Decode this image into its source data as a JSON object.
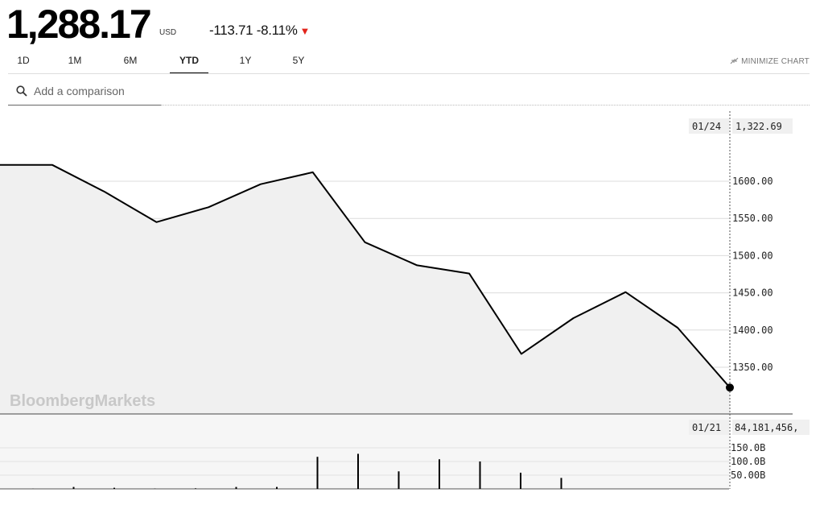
{
  "quote": {
    "price": "1,288.17",
    "currency": "USD",
    "change": "-113.71",
    "change_pct": "-8.11%",
    "direction_icon": "down-triangle-icon",
    "down_color": "#e2241b"
  },
  "tabs": [
    {
      "label": "1D",
      "active": false
    },
    {
      "label": "1M",
      "active": false
    },
    {
      "label": "6M",
      "active": false
    },
    {
      "label": "YTD",
      "active": true
    },
    {
      "label": "1Y",
      "active": false
    },
    {
      "label": "5Y",
      "active": false
    }
  ],
  "minimize_label": "MINIMIZE CHART",
  "search": {
    "placeholder": "Add a comparison",
    "icon": "search-icon"
  },
  "watermark": "BloombergMarkets",
  "chart_data": [
    {
      "type": "line",
      "series": [
        {
          "values": [
            1622,
            1622,
            1586,
            1545,
            1565,
            1596,
            1612,
            1518,
            1487,
            1476,
            1368,
            1416,
            1451,
            1403,
            1322.69
          ]
        }
      ],
      "y_ticks": [
        "1600.00",
        "1550.00",
        "1500.00",
        "1450.00",
        "1400.00",
        "1350.00"
      ],
      "ylim": [
        1300,
        1650
      ],
      "grid": true,
      "crosshair": {
        "date": "01/24",
        "value": "1,322.69"
      }
    },
    {
      "type": "bar",
      "values": [
        0.5,
        7,
        4,
        1,
        2,
        7,
        7,
        117,
        128,
        64,
        108,
        100,
        59,
        40
      ],
      "unit": "B",
      "y_ticks": [
        "150.0B",
        "100.0B",
        "50.00B"
      ],
      "ylim": [
        0,
        160
      ],
      "crosshair": {
        "date": "01/21",
        "value": "84,181,456,"
      }
    }
  ]
}
